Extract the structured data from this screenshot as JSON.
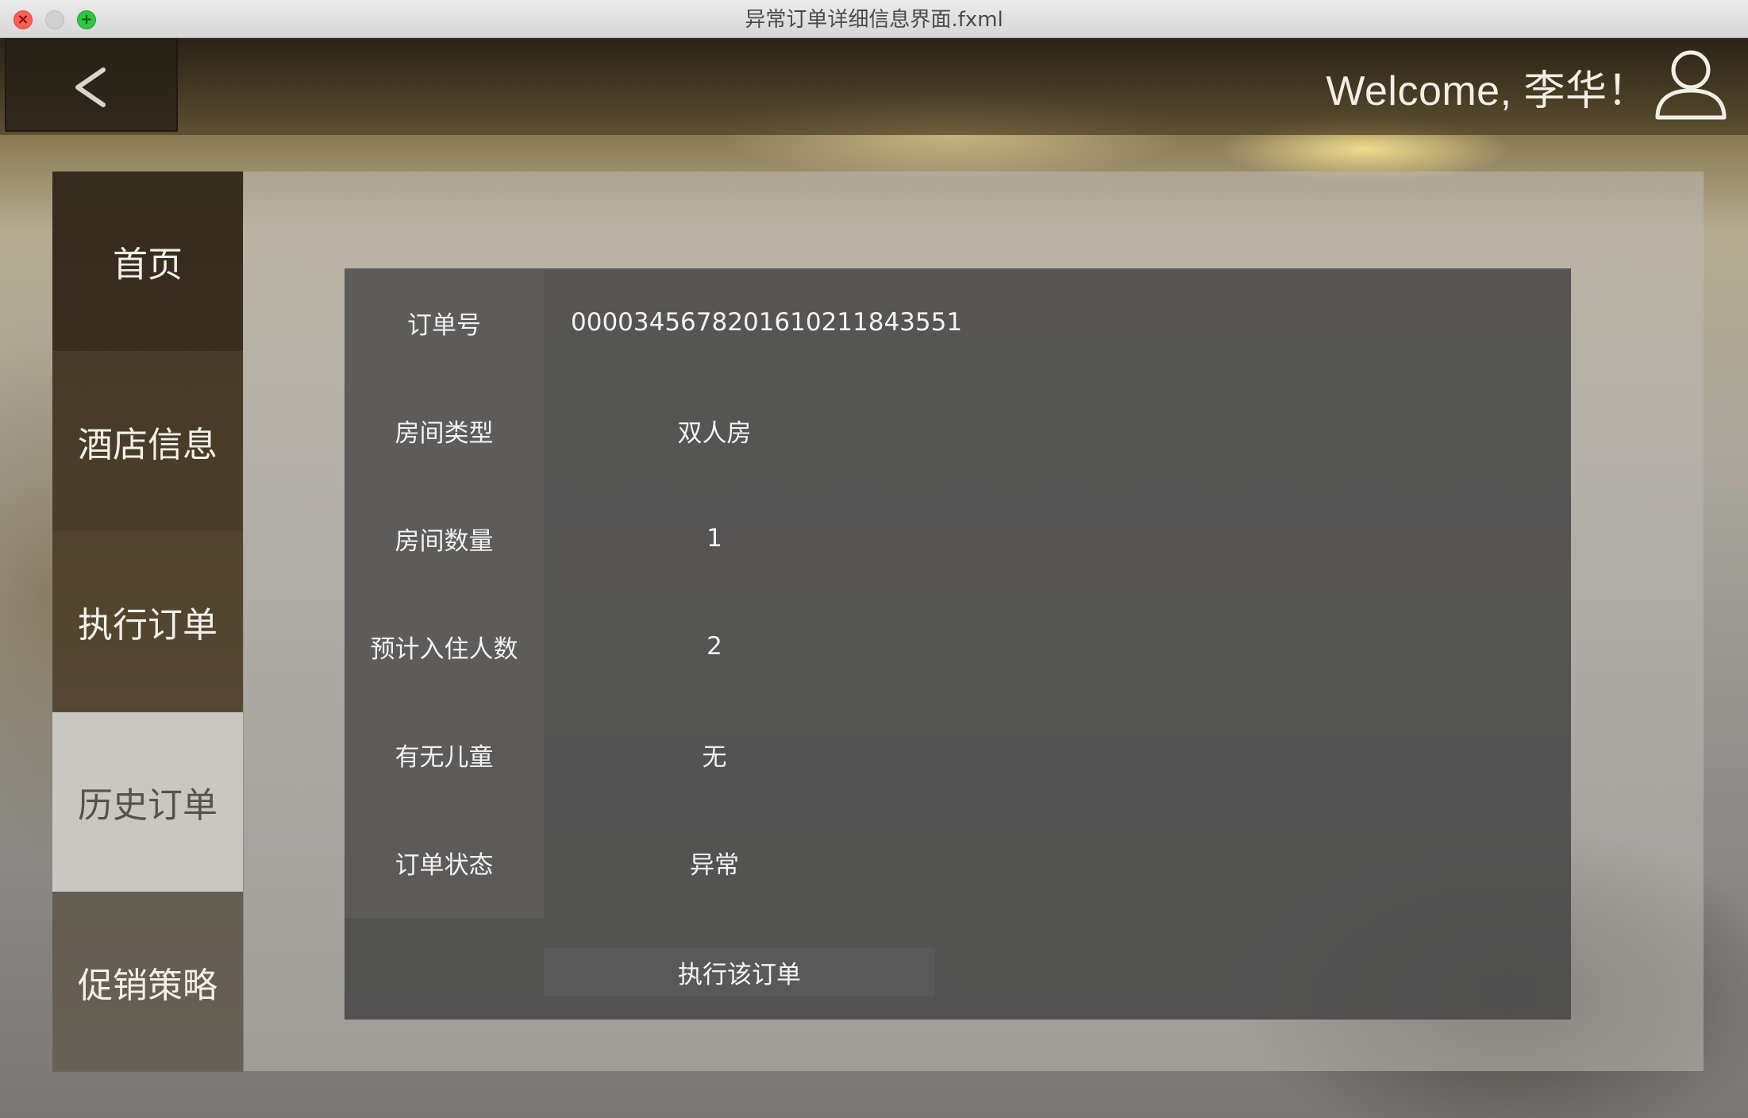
{
  "window": {
    "title": "异常订单详细信息界面.fxml",
    "close_glyph": "×",
    "maximize_glyph": "+"
  },
  "header": {
    "back_icon": "chevron-left-icon",
    "welcome_text": "Welcome, 李华！",
    "avatar_icon": "user-avatar-icon"
  },
  "sidebar": {
    "items": [
      {
        "label": "首页"
      },
      {
        "label": "酒店信息"
      },
      {
        "label": "执行订单"
      },
      {
        "label": "历史订单",
        "selected": true
      },
      {
        "label": "促销策略"
      }
    ]
  },
  "order_detail": {
    "rows": [
      {
        "label": "订单号",
        "value": "0000345678201610211843551"
      },
      {
        "label": "房间类型",
        "value": "双人房"
      },
      {
        "label": "房间数量",
        "value": "1"
      },
      {
        "label": "预计入住人数",
        "value": "2"
      },
      {
        "label": "有无儿童",
        "value": "无"
      },
      {
        "label": "订单状态",
        "value": "异常"
      }
    ],
    "execute_button": "执行该订单"
  },
  "colors": {
    "selected_nav_bg": "#c9c7c2",
    "card_bg": "#484848",
    "text": "#f2f2f2"
  }
}
